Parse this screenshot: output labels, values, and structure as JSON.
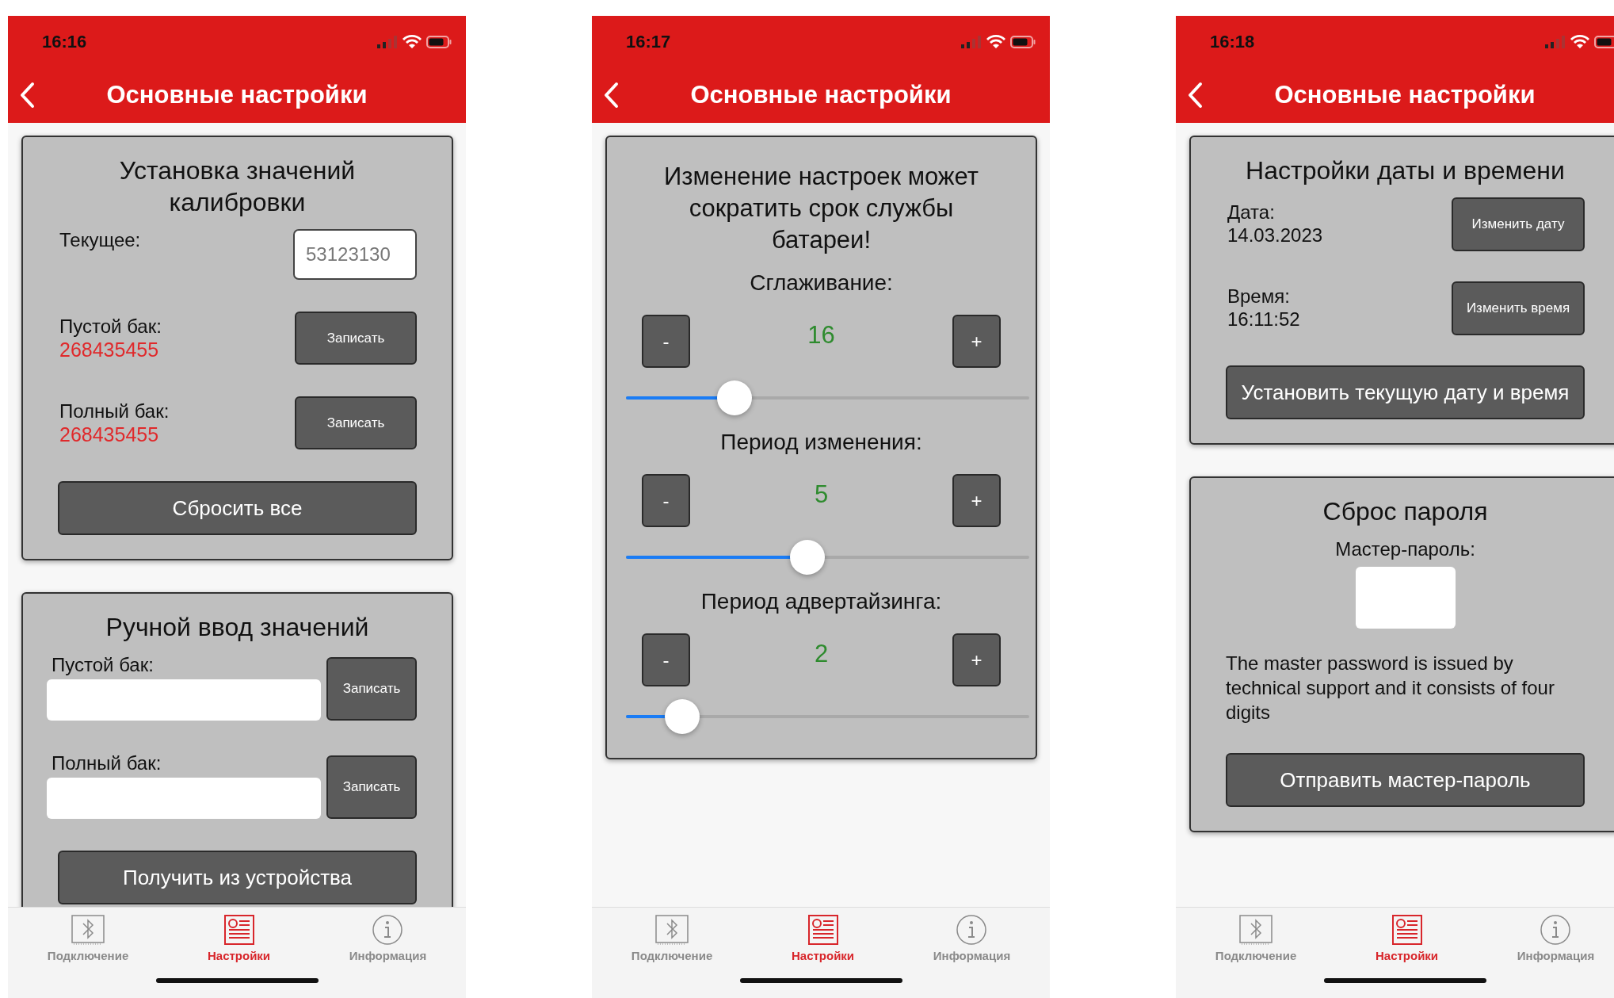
{
  "phones": [
    {
      "status_bar": {
        "time": "16:16"
      },
      "nav_bar": {
        "title": "Основные настройки"
      },
      "cards": [
        {
          "rows": [
            {
              "kind": "title",
              "text": "Установка значений калибровки"
            },
            {
              "kind": "field",
              "label": "Текущее:",
              "placeholder": "53123130"
            },
            {
              "kind": "reading",
              "label": "Пустой бак:",
              "value": "268435455",
              "button": "Записать"
            },
            {
              "kind": "reading",
              "label": "Полный бак:",
              "value": "268435455",
              "button": "Записать"
            },
            {
              "kind": "wide_button",
              "button": "Сбросить все"
            }
          ]
        },
        {
          "rows": [
            {
              "kind": "title",
              "text": "Ручной ввод значений"
            },
            {
              "kind": "input",
              "label": "Пустой бак:",
              "button": "Записать"
            },
            {
              "kind": "input",
              "label": "Полный бак:",
              "button": "Записать"
            },
            {
              "kind": "wide_button",
              "button": "Получить из устройства"
            }
          ]
        }
      ],
      "tabs": [
        {
          "label": "Подключение",
          "selected": false
        },
        {
          "label": "Настройки",
          "selected": true
        },
        {
          "label": "Информация",
          "selected": false
        }
      ]
    },
    {
      "status_bar": {
        "time": "16:17"
      },
      "nav_bar": {
        "title": "Основные настройки"
      },
      "cards": [
        {
          "rows": [
            {
              "kind": "notice",
              "text": "Изменение настроек может сократить срок службы батареи!"
            },
            {
              "kind": "stepper",
              "label": "Сглаживание:",
              "minus": "-",
              "value": "16",
              "plus": "+",
              "level": 0.27
            },
            {
              "kind": "stepper",
              "label": "Период изменения:",
              "minus": "-",
              "value": "5",
              "plus": "+",
              "level": 0.45
            },
            {
              "kind": "stepper",
              "label": "Период адвертайзинга:",
              "minus": "-",
              "value": "2",
              "plus": "+",
              "level": 0.14
            }
          ]
        }
      ],
      "tabs": [
        {
          "label": "Подключение",
          "selected": false
        },
        {
          "label": "Настройки",
          "selected": true
        },
        {
          "label": "Информация",
          "selected": false
        }
      ]
    },
    {
      "status_bar": {
        "time": "16:18"
      },
      "nav_bar": {
        "title": "Основные настройки"
      },
      "cards": [
        {
          "rows": [
            {
              "kind": "title",
              "text": "Настройки даты и времени"
            },
            {
              "kind": "info",
              "label": "Дата:",
              "value": "14.03.2023",
              "button": "Изменить дату"
            },
            {
              "kind": "info",
              "label": "Время:",
              "value": "16:11:52",
              "button": "Изменить время"
            },
            {
              "kind": "wide_button",
              "button": "Установить текущую дату и время"
            }
          ]
        },
        {
          "rows": [
            {
              "kind": "title",
              "text": "Сброс пароля"
            },
            {
              "kind": "small_field",
              "label": "Мастер-пароль:"
            },
            {
              "kind": "paragraph",
              "text": "The master password is issued by technical support and it consists of four digits"
            },
            {
              "kind": "wide_button",
              "button": "Отправить мастер-пароль"
            }
          ]
        }
      ],
      "tabs": [
        {
          "label": "Подключение",
          "selected": false
        },
        {
          "label": "Настройки",
          "selected": true
        },
        {
          "label": "Информация",
          "selected": false
        }
      ]
    }
  ]
}
